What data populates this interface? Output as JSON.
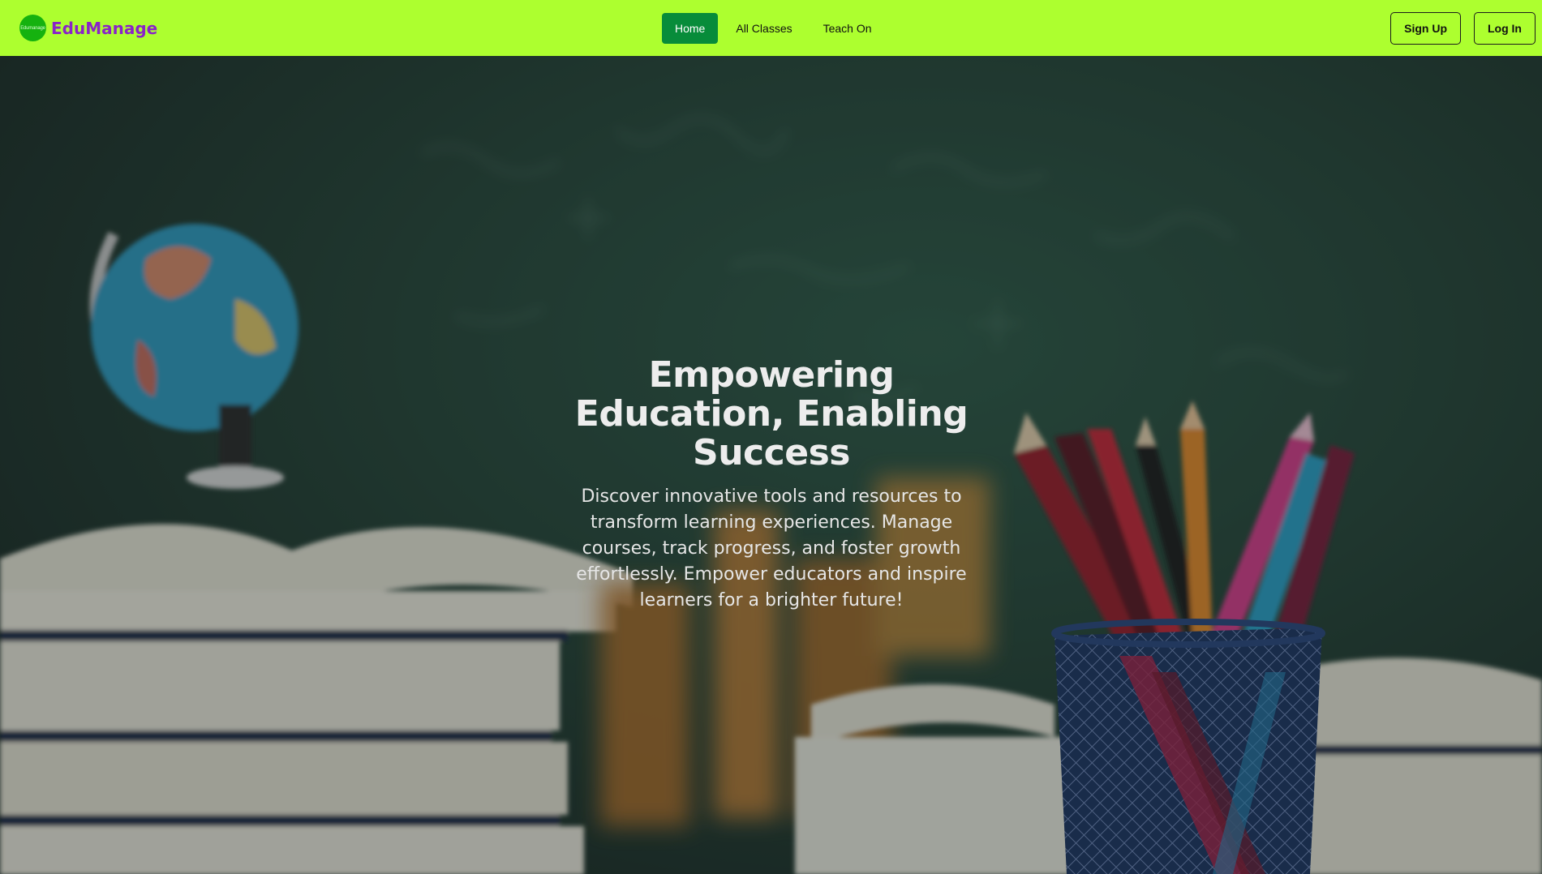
{
  "navbar": {
    "logo_text": "Edumanage",
    "brand_name": "EduManage",
    "menu": [
      {
        "label": "Home",
        "active": true
      },
      {
        "label": "All Classes",
        "active": false
      },
      {
        "label": "Teach On",
        "active": false
      }
    ],
    "signup_label": "Sign Up",
    "login_label": "Log In"
  },
  "hero": {
    "title": "Empowering Education, Enabling Success",
    "description": "Discover innovative tools and resources to transform learning experiences. Manage courses, track progress, and foster growth effortlessly. Empower educators and inspire learners for a brighter future!"
  },
  "colors": {
    "navbar_bg": "#adff2f",
    "brand_text": "#8a23c9",
    "active_nav": "#078c3a",
    "logo_bg": "#15b20f"
  }
}
